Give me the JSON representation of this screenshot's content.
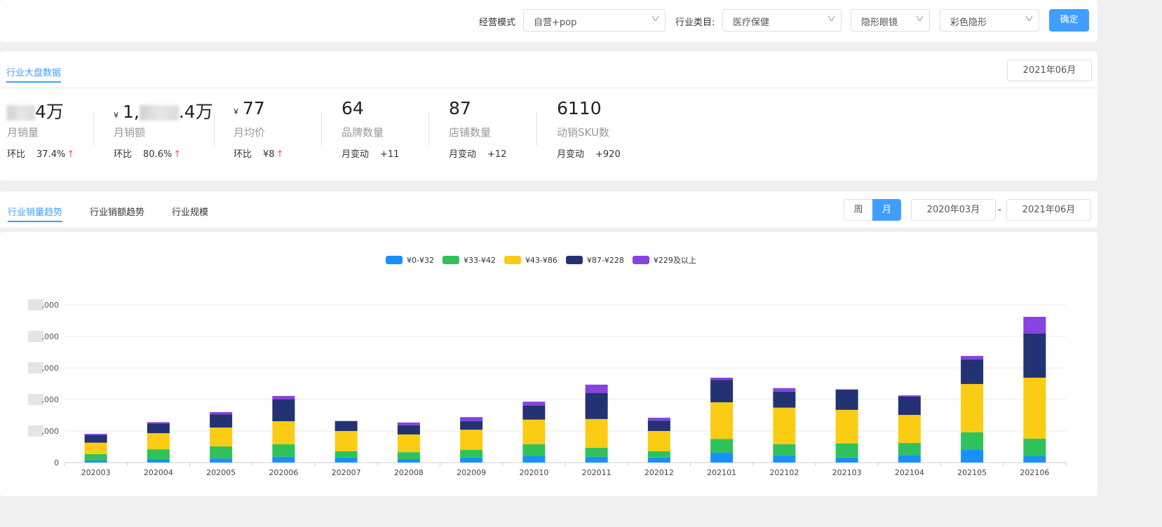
{
  "filters": {
    "mode_label": "经营模式",
    "mode_value": "自营+pop",
    "category_label": "行业类目:",
    "cat1": "医疗保健",
    "cat2": "隐形眼镜",
    "cat3": "彩色隐形",
    "confirm": "确定"
  },
  "overview": {
    "title": "行业大盘数据",
    "month": "2021年06月",
    "stats": [
      {
        "value_suffix": "4万",
        "name": "月销量",
        "sub_label": "环比",
        "sub_value": "37.4%",
        "trend": "↑"
      },
      {
        "prefix": "¥",
        "value_head": "1,",
        "value_suffix": ".4万",
        "name": "月销额",
        "sub_label": "环比",
        "sub_value": "80.6%",
        "trend": "↑"
      },
      {
        "prefix": "¥",
        "value": "77",
        "name": "月均价",
        "sub_label": "环比",
        "sub_value": "¥8",
        "trend": "↑"
      },
      {
        "value": "64",
        "name": "品牌数量",
        "sub_label": "月变动",
        "sub_value": "+11"
      },
      {
        "value": "87",
        "name": "店铺数量",
        "sub_label": "月变动",
        "sub_value": "+12"
      },
      {
        "value": "6110",
        "name": "动销SKU数",
        "sub_label": "月变动",
        "sub_value": "+920"
      }
    ]
  },
  "trend": {
    "tabs": [
      "行业销量趋势",
      "行业销额趋势",
      "行业规模"
    ],
    "week": "周",
    "month": "月",
    "start": "2020年03月",
    "sep": "-",
    "end": "2021年06月"
  },
  "chart_data": {
    "type": "bar",
    "stacked": true,
    "categories": [
      "202003",
      "202004",
      "202005",
      "202006",
      "202007",
      "202008",
      "202009",
      "202010",
      "202011",
      "202012",
      "202101",
      "202102",
      "202103",
      "202104",
      "202105",
      "202106"
    ],
    "y_ticks": [
      "0",
      ",000",
      ",000",
      ",000",
      ",000",
      ",000"
    ],
    "ylim": [
      0,
      5000
    ],
    "series": [
      {
        "name": "¥0-¥32",
        "color": "#1890ff",
        "values": [
          70,
          110,
          130,
          180,
          160,
          110,
          160,
          200,
          180,
          160,
          310,
          220,
          160,
          240,
          400,
          200
        ]
      },
      {
        "name": "¥33-¥42",
        "color": "#2fc25b",
        "values": [
          200,
          310,
          380,
          400,
          200,
          220,
          240,
          380,
          290,
          200,
          440,
          360,
          440,
          380,
          560,
          560
        ]
      },
      {
        "name": "¥43-¥86",
        "color": "#facc14",
        "values": [
          360,
          510,
          600,
          730,
          640,
          560,
          640,
          780,
          910,
          640,
          1160,
          1160,
          1070,
          890,
          1530,
          1930
        ]
      },
      {
        "name": "¥87-¥228",
        "color": "#223273",
        "values": [
          240,
          310,
          420,
          690,
          310,
          290,
          270,
          440,
          820,
          330,
          710,
          510,
          640,
          580,
          780,
          1400
        ]
      },
      {
        "name": "¥229及以上",
        "color": "#8543e0",
        "values": [
          40,
          40,
          70,
          110,
          10,
          90,
          130,
          130,
          270,
          90,
          70,
          110,
          10,
          40,
          110,
          530
        ]
      }
    ],
    "legend": "top-center",
    "grid": true
  }
}
